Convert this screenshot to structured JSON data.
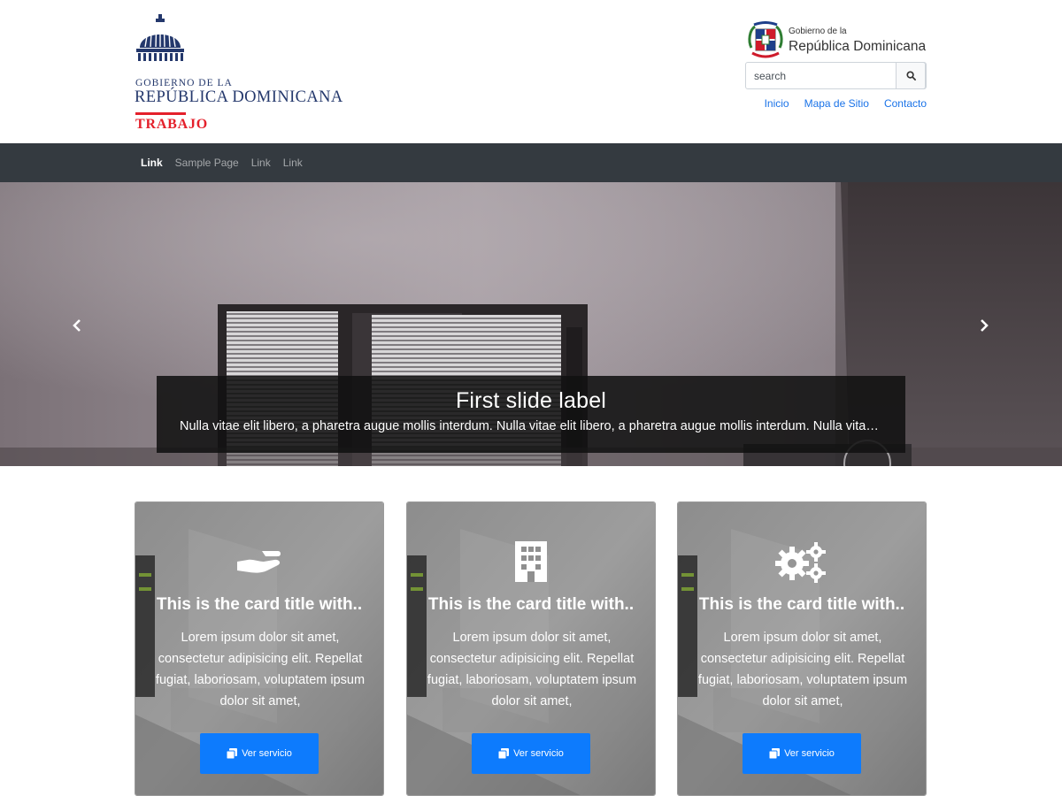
{
  "header": {
    "logo": {
      "line1": "GOBIERNO DE LA",
      "line2": "REPÚBLICA DOMINICANA",
      "ministry": "TRABAJO"
    },
    "gov_badge": {
      "line1": "Gobierno de la",
      "line2": "República Dominicana"
    },
    "search": {
      "placeholder": "search",
      "value": ""
    },
    "links": [
      {
        "label": "Inicio"
      },
      {
        "label": "Mapa de Sitio"
      },
      {
        "label": "Contacto"
      }
    ]
  },
  "navbar": {
    "items": [
      {
        "label": "Link",
        "active": true
      },
      {
        "label": "Sample Page",
        "active": false
      },
      {
        "label": "Link",
        "active": false
      },
      {
        "label": "Link",
        "active": false
      }
    ]
  },
  "carousel": {
    "caption_title": "First slide label",
    "caption_text": "Nulla vitae elit libero, a pharetra augue mollis interdum. Nulla vitae elit libero, a pharetra augue mollis interdum. Nulla vitae elit libero, a pharetra augue mollis interdum."
  },
  "cards": [
    {
      "icon": "hand-holding-icon",
      "title": "This is the card title with..",
      "text": "Lorem ipsum dolor sit amet, consectetur adipisicing elit. Repellat fugiat, laboriosam, voluptatem ipsum dolor sit amet,",
      "button_label": "Ver servicio"
    },
    {
      "icon": "building-icon",
      "title": "This is the card title with..",
      "text": "Lorem ipsum dolor sit amet, consectetur adipisicing elit. Repellat fugiat, laboriosam, voluptatem ipsum dolor sit amet,",
      "button_label": "Ver servicio"
    },
    {
      "icon": "gears-icon",
      "title": "This is the card title with..",
      "text": "Lorem ipsum dolor sit amet, consectetur adipisicing elit. Repellat fugiat, laboriosam, voluptatem ipsum dolor sit amet,",
      "button_label": "Ver servicio"
    }
  ],
  "colors": {
    "brand_blue": "#24386c",
    "brand_red": "#e4202b",
    "navbar": "#343a40",
    "link": "#1a73e8",
    "button": "#0d7bfd"
  }
}
